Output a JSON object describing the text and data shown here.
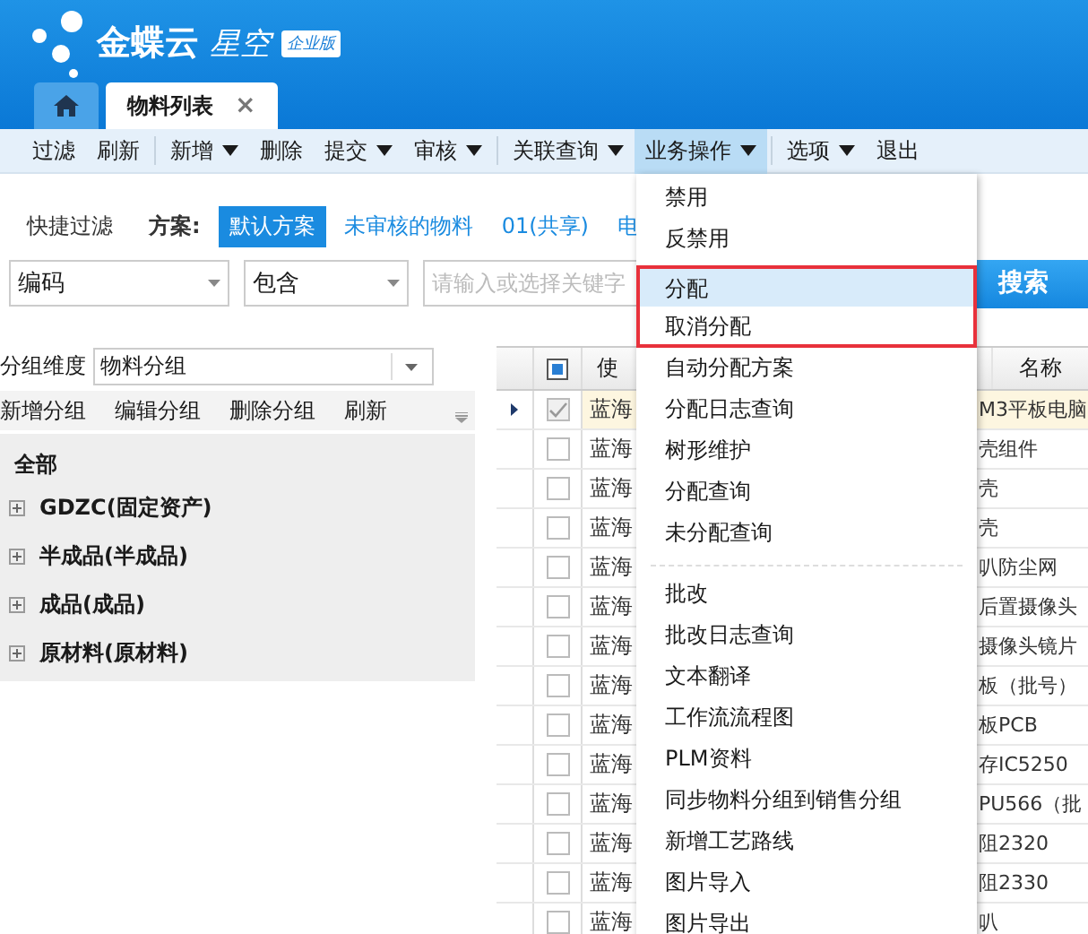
{
  "brand": {
    "name": "金蝶云",
    "product": "星空",
    "edition": "企业版"
  },
  "tabs": [
    {
      "kind": "home",
      "selected": false
    },
    {
      "kind": "page",
      "label": "物料列表",
      "close": "×",
      "selected": true
    }
  ],
  "toolbar": [
    [
      {
        "label": "过滤",
        "dropdown": false,
        "selected": false
      },
      {
        "label": "刷新",
        "dropdown": false,
        "selected": false
      }
    ],
    [
      {
        "label": "新增",
        "dropdown": true,
        "selected": false
      },
      {
        "label": "删除",
        "dropdown": false,
        "selected": false
      },
      {
        "label": "提交",
        "dropdown": true,
        "selected": false
      },
      {
        "label": "审核",
        "dropdown": true,
        "selected": false
      }
    ],
    [
      {
        "label": "关联查询",
        "dropdown": true,
        "selected": false
      },
      {
        "label": "业务操作",
        "dropdown": true,
        "selected": true
      }
    ],
    [
      {
        "label": "选项",
        "dropdown": true,
        "selected": false
      },
      {
        "label": "退出",
        "dropdown": false,
        "selected": false
      }
    ]
  ],
  "quick_filter": {
    "label": "快捷过滤",
    "scheme_label": "方案:",
    "schemes": [
      {
        "label": "默认方案",
        "selected": true
      },
      {
        "label": "未审核的物料",
        "selected": false
      },
      {
        "label": "01(共享)",
        "selected": false
      },
      {
        "label": "电",
        "selected": false
      }
    ]
  },
  "search": {
    "field": "编码",
    "operator": "包含",
    "placeholder": "请输入或选择关键字",
    "button": "搜索"
  },
  "group_panel": {
    "dimension_label": "分组维度",
    "dimension": "物料分组",
    "actions": [
      "新增分组",
      "编辑分组",
      "删除分组",
      "刷新"
    ],
    "tree": [
      {
        "label": "全部",
        "children": [
          {
            "label": "GDZC(固定资产)",
            "expanded": false
          },
          {
            "label": "半成品(半成品)",
            "expanded": false
          },
          {
            "label": "成品(成品)",
            "expanded": false
          },
          {
            "label": "原材料(原材料)",
            "expanded": false
          }
        ]
      }
    ]
  },
  "table": {
    "header_checked": true,
    "columns": [
      "使",
      "名称"
    ],
    "rows": [
      {
        "cells": [
          "蓝海",
          "M3平板电脑"
        ],
        "checked": true,
        "selected": true
      },
      {
        "cells": [
          "蓝海",
          "壳组件"
        ],
        "checked": false,
        "selected": false
      },
      {
        "cells": [
          "蓝海",
          "壳"
        ],
        "checked": false,
        "selected": false
      },
      {
        "cells": [
          "蓝海",
          "壳"
        ],
        "checked": false,
        "selected": false
      },
      {
        "cells": [
          "蓝海",
          "叭防尘网"
        ],
        "checked": false,
        "selected": false
      },
      {
        "cells": [
          "蓝海",
          "后置摄像头"
        ],
        "checked": false,
        "selected": false
      },
      {
        "cells": [
          "蓝海",
          "摄像头镜片"
        ],
        "checked": false,
        "selected": false
      },
      {
        "cells": [
          "蓝海",
          "板（批号）"
        ],
        "checked": false,
        "selected": false
      },
      {
        "cells": [
          "蓝海",
          "板PCB"
        ],
        "checked": false,
        "selected": false
      },
      {
        "cells": [
          "蓝海",
          "存IC5250"
        ],
        "checked": false,
        "selected": false
      },
      {
        "cells": [
          "蓝海",
          "PU566（批"
        ],
        "checked": false,
        "selected": false
      },
      {
        "cells": [
          "蓝海",
          "阻2320"
        ],
        "checked": false,
        "selected": false
      },
      {
        "cells": [
          "蓝海",
          "阻2330"
        ],
        "checked": false,
        "selected": false
      },
      {
        "cells": [
          "蓝海",
          "叭"
        ],
        "checked": false,
        "selected": false
      }
    ]
  },
  "menu": [
    {
      "kind": "item",
      "label": "禁用",
      "selected": false,
      "outlined": false
    },
    {
      "kind": "item",
      "label": "反禁用",
      "selected": false,
      "outlined": false
    },
    {
      "kind": "item",
      "label": "分配",
      "selected": true,
      "outlined": true
    },
    {
      "kind": "item",
      "label": "取消分配",
      "selected": false,
      "outlined": true
    },
    {
      "kind": "item",
      "label": "自动分配方案",
      "selected": false,
      "outlined": false
    },
    {
      "kind": "item",
      "label": "分配日志查询",
      "selected": false,
      "outlined": false
    },
    {
      "kind": "item",
      "label": "树形维护",
      "selected": false,
      "outlined": false
    },
    {
      "kind": "item",
      "label": "分配查询",
      "selected": false,
      "outlined": false
    },
    {
      "kind": "item",
      "label": "未分配查询",
      "selected": false,
      "outlined": false
    },
    {
      "kind": "separator"
    },
    {
      "kind": "item",
      "label": "批改",
      "selected": false,
      "outlined": false
    },
    {
      "kind": "item",
      "label": "批改日志查询",
      "selected": false,
      "outlined": false
    },
    {
      "kind": "item",
      "label": "文本翻译",
      "selected": false,
      "outlined": false
    },
    {
      "kind": "item",
      "label": "工作流流程图",
      "selected": false,
      "outlined": false
    },
    {
      "kind": "item",
      "label": "PLM资料",
      "selected": false,
      "outlined": false
    },
    {
      "kind": "item",
      "label": "同步物料分组到销售分组",
      "selected": false,
      "outlined": false
    },
    {
      "kind": "item",
      "label": "新增工艺路线",
      "selected": false,
      "outlined": false
    },
    {
      "kind": "item",
      "label": "图片导入",
      "selected": false,
      "outlined": false
    },
    {
      "kind": "item",
      "label": "图片导出",
      "selected": false,
      "outlined": false
    }
  ]
}
